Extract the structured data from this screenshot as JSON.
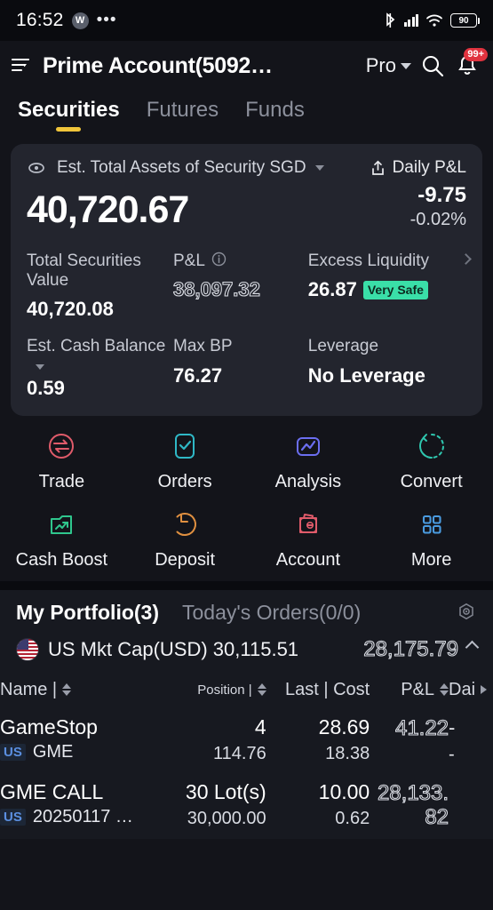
{
  "status_bar": {
    "time": "16:52",
    "w_badge": "W",
    "overflow": "•••",
    "battery_level": "90",
    "icons": [
      "bluetooth-icon",
      "cellular-signal-icon",
      "wifi-icon",
      "battery-icon"
    ]
  },
  "header": {
    "menu_icon": "list-menu-icon",
    "title": "Prime Account(5092…",
    "mode_label": "Pro",
    "search_icon": "search-icon",
    "bell_icon": "bell-icon",
    "notification_badge": "99+"
  },
  "tabs": [
    {
      "label": "Securities",
      "active": true
    },
    {
      "label": "Futures",
      "active": false
    },
    {
      "label": "Funds",
      "active": false
    }
  ],
  "assets_card": {
    "eye_icon": "eye-icon",
    "label": "Est. Total Assets of Security SGD",
    "share_icon": "share-icon",
    "daily_pl_label": "Daily P&L",
    "total_value": "40,720.67",
    "daily_pl_value": "-9.75",
    "daily_pl_percent": "-0.02%",
    "metrics": [
      {
        "label": "Total Securities Value",
        "value": "40,720.08",
        "info": false,
        "badge": "",
        "outlined": false,
        "dropdown": false,
        "arrow": false
      },
      {
        "label": "P&L",
        "value": "38,097.32",
        "info": true,
        "badge": "",
        "outlined": true,
        "dropdown": false,
        "arrow": false
      },
      {
        "label": "Excess Liquidity",
        "value": "26.87",
        "info": false,
        "badge": "Very Safe",
        "outlined": false,
        "dropdown": false,
        "arrow": true
      },
      {
        "label": "Est. Cash Balance",
        "value": "0.59",
        "info": false,
        "badge": "",
        "outlined": false,
        "dropdown": true,
        "arrow": false
      },
      {
        "label": "Max BP",
        "value": "76.27",
        "info": false,
        "badge": "",
        "outlined": false,
        "dropdown": false,
        "arrow": false
      },
      {
        "label": "Leverage",
        "value": "No Leverage",
        "info": false,
        "badge": "",
        "outlined": false,
        "dropdown": false,
        "arrow": false
      }
    ]
  },
  "quick_actions": [
    [
      {
        "label": "Trade",
        "icon": "trade-exchange-icon",
        "color": "#e05b6a"
      },
      {
        "label": "Orders",
        "icon": "orders-checklist-icon",
        "color": "#2fb8c6"
      },
      {
        "label": "Analysis",
        "icon": "analysis-chart-icon",
        "color": "#6b6ef0"
      },
      {
        "label": "Convert",
        "icon": "convert-refresh-icon",
        "color": "#2fc6ae"
      }
    ],
    [
      {
        "label": "Cash Boost",
        "icon": "cash-boost-folder-icon",
        "color": "#2fc68d"
      },
      {
        "label": "Deposit",
        "icon": "deposit-arrow-icon",
        "color": "#e09040"
      },
      {
        "label": "Account",
        "icon": "account-wallet-icon",
        "color": "#e05b6a"
      },
      {
        "label": "More",
        "icon": "more-grid-icon",
        "color": "#4a9be0"
      }
    ]
  ],
  "portfolio": {
    "tabs": [
      {
        "label": "My Portfolio(3)",
        "active": true
      },
      {
        "label": "Today's Orders(0/0)",
        "active": false
      }
    ],
    "gear_icon": "settings-gear-icon",
    "market_row": {
      "flag_icon": "us-flag-icon",
      "label": "US Mkt Cap(USD) 30,115.51",
      "value": "28,175.79",
      "chevron": "chevron-up-icon"
    },
    "table": {
      "columns": [
        {
          "label": "Name |",
          "sortable": true,
          "small": false,
          "arrow": false
        },
        {
          "label": "Position |",
          "sortable": true,
          "small": true,
          "arrow": false
        },
        {
          "label": "Last | Cost",
          "sortable": false,
          "small": false,
          "arrow": false
        },
        {
          "label": "P&L",
          "sortable": true,
          "small": false,
          "arrow": false
        },
        {
          "label": "Dai",
          "sortable": false,
          "small": false,
          "arrow": true
        }
      ],
      "rows": [
        {
          "name": "GameStop",
          "region": "US",
          "symbol": "GME",
          "position": "4",
          "market_value": "114.76",
          "last": "28.69",
          "cost": "18.38",
          "pl": "41.22",
          "daily_1": "-",
          "daily_2": "-"
        },
        {
          "name": "GME CALL",
          "region": "US",
          "symbol": "20250117 …",
          "position": "30 Lot(s)",
          "market_value": "30,000.00",
          "last": "10.00",
          "cost": "0.62",
          "pl": "28,133.82",
          "daily_1": "",
          "daily_2": ""
        }
      ]
    }
  },
  "colors": {
    "page_bg": "#13141a",
    "card_bg": "#23252e",
    "accent_tab": "#f0c53a",
    "badge_green": "#3adfa8",
    "badge_red": "#e0333f",
    "region_tag": "#5b8fe0"
  }
}
